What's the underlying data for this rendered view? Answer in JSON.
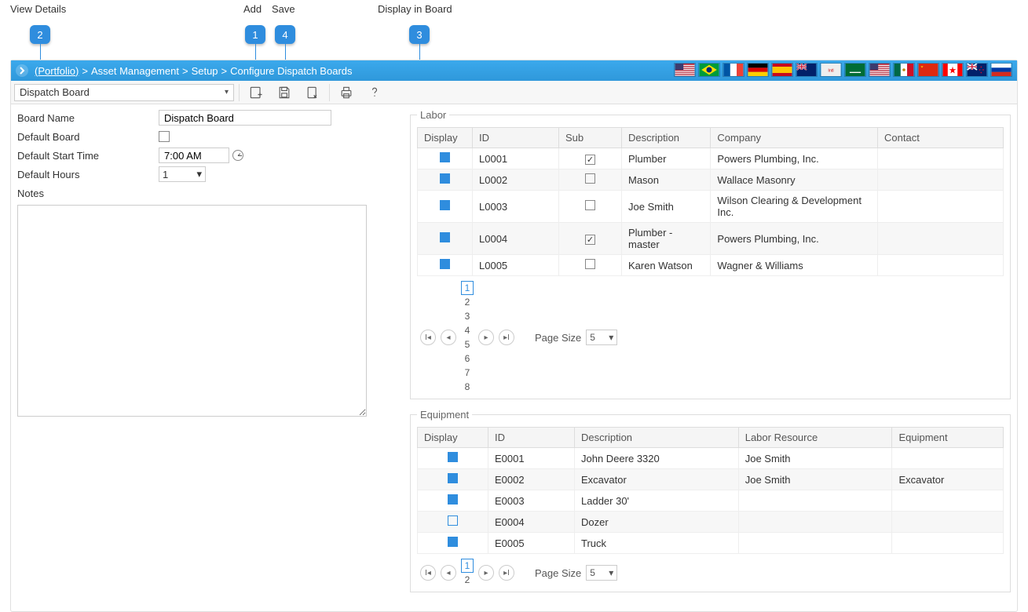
{
  "callouts": {
    "view_details": {
      "label": "View Details",
      "num": "2"
    },
    "add": {
      "label": "Add",
      "num": "1"
    },
    "save": {
      "label": "Save",
      "num": "4"
    },
    "display_in_board": {
      "label": "Display in Board",
      "num": "3"
    }
  },
  "breadcrumb": {
    "portfolio": "(Portfolio)",
    "sep": ">",
    "items": [
      "Asset Management",
      "Setup",
      "Configure Dispatch Boards"
    ]
  },
  "flags": [
    "us",
    "br",
    "fr",
    "de",
    "es",
    "au",
    "intl",
    "sa",
    "us2",
    "mx",
    "cn",
    "ca",
    "nz",
    "ru"
  ],
  "toolbar": {
    "dropdown_value": "Dispatch Board"
  },
  "form": {
    "board_name_label": "Board Name",
    "board_name_value": "Dispatch Board",
    "default_board_label": "Default Board",
    "default_board_checked": false,
    "default_start_label": "Default Start Time",
    "default_start_value": "7:00 AM",
    "default_hours_label": "Default Hours",
    "default_hours_value": "1",
    "notes_label": "Notes",
    "notes_value": ""
  },
  "labor": {
    "legend": "Labor",
    "headers": [
      "Display",
      "ID",
      "Sub",
      "Description",
      "Company",
      "Contact"
    ],
    "rows": [
      {
        "display": true,
        "id": "L0001",
        "sub": true,
        "desc": "Plumber",
        "company": "Powers Plumbing, Inc.",
        "contact": ""
      },
      {
        "display": true,
        "id": "L0002",
        "sub": false,
        "desc": "Mason",
        "company": "Wallace Masonry",
        "contact": ""
      },
      {
        "display": true,
        "id": "L0003",
        "sub": false,
        "desc": "Joe Smith",
        "company": "Wilson Clearing & Development Inc.",
        "contact": ""
      },
      {
        "display": true,
        "id": "L0004",
        "sub": true,
        "desc": "Plumber - master",
        "company": "Powers Plumbing, Inc.",
        "contact": ""
      },
      {
        "display": true,
        "id": "L0005",
        "sub": false,
        "desc": "Karen Watson",
        "company": "Wagner & Williams",
        "contact": ""
      }
    ],
    "pages": [
      "1",
      "2",
      "3",
      "4",
      "5",
      "6",
      "7",
      "8"
    ],
    "active_page": "1",
    "page_size_label": "Page Size",
    "page_size": "5"
  },
  "equipment": {
    "legend": "Equipment",
    "headers": [
      "Display",
      "ID",
      "Description",
      "Labor Resource",
      "Equipment"
    ],
    "rows": [
      {
        "display": true,
        "id": "E0001",
        "desc": "John Deere 3320",
        "labor": "Joe Smith",
        "equip": ""
      },
      {
        "display": true,
        "id": "E0002",
        "desc": "Excavator",
        "labor": "Joe Smith",
        "equip": "Excavator"
      },
      {
        "display": true,
        "id": "E0003",
        "desc": "Ladder 30'",
        "labor": "",
        "equip": ""
      },
      {
        "display": false,
        "id": "E0004",
        "desc": "Dozer",
        "labor": "",
        "equip": ""
      },
      {
        "display": true,
        "id": "E0005",
        "desc": "Truck",
        "labor": "",
        "equip": ""
      }
    ],
    "pages": [
      "1",
      "2"
    ],
    "active_page": "1",
    "page_size_label": "Page Size",
    "page_size": "5"
  }
}
